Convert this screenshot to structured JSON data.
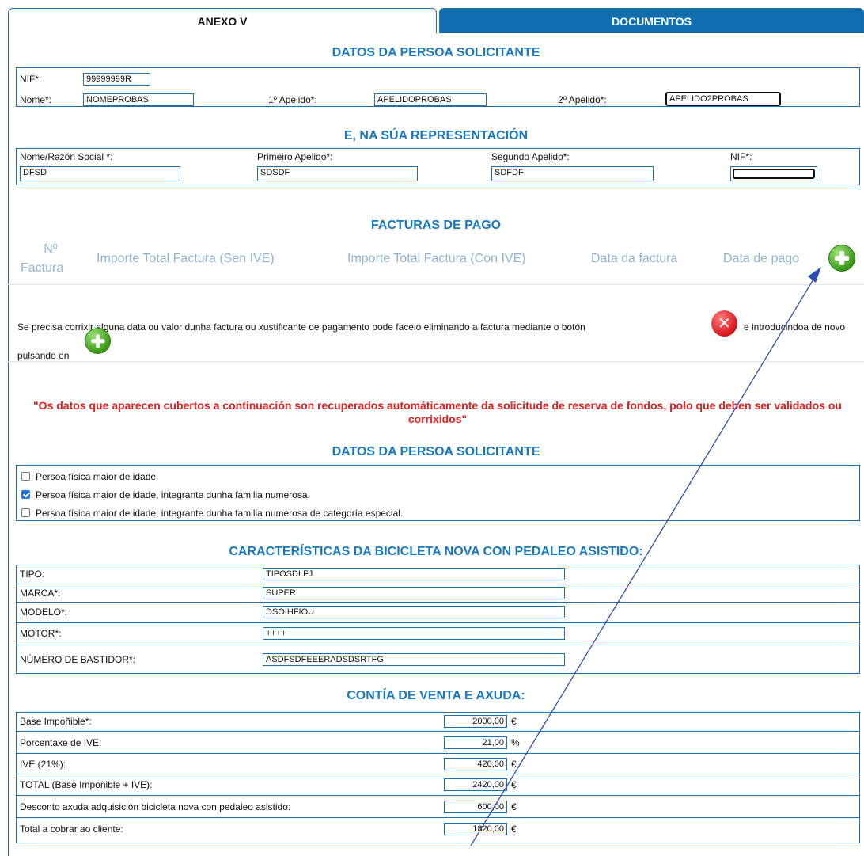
{
  "tabs": {
    "anexo": "ANEXO V",
    "documentos": "DOCUMENTOS"
  },
  "solicitante": {
    "title": "DATOS DA PERSOA SOLICITANTE",
    "nif_label": "NIF*:",
    "nif": "99999999R",
    "nome_label": "Nome*:",
    "nome": "NOMEPROBAS",
    "ap1_label": "1º Apelido*:",
    "ap1": "APELIDOPROBAS",
    "ap2_label": "2º Apelido*:",
    "ap2": "APELIDO2PROBAS"
  },
  "representacion": {
    "title": "E, NA SÚA REPRESENTACIÓN",
    "nome_label": "Nome/Razón Social *:",
    "nome": "DFSD",
    "ap1_label": "Primeiro Apelido*:",
    "ap1": "SDSDF",
    "ap2_label": "Segundo Apelido*:",
    "ap2": "SDFDF",
    "nif_label": "NIF*:",
    "nif": ""
  },
  "facturas": {
    "title": "FACTURAS DE PAGO",
    "col_num_1": "Nº",
    "col_num_2": "Factura",
    "col_sen_ive": "Importe Total Factura (Sen IVE)",
    "col_con_ive": "Importe Total Factura (Con IVE)",
    "col_data_factura": "Data da factura",
    "col_data_pago": "Data de pago",
    "help_1": "Se precisa corrixir alguna data ou valor dunha factura ou xustificante de pagamento pode facelo eliminando a factura mediante o botón",
    "help_2": "e introducindoa de novo",
    "help_3": "pulsando en"
  },
  "warning": "\"Os datos que aparecen cubertos a continuación son recuperados automáticamente da solicitude de reserva de fondos, polo que deben ser validados ou corrixidos\"",
  "tipo_solicitante": {
    "title": "DATOS DA PERSOA SOLICITANTE",
    "options": [
      {
        "label": "Persoa física maior de idade",
        "checked": false
      },
      {
        "label": "Persoa física maior de idade, integrante dunha familia numerosa.",
        "checked": true
      },
      {
        "label": "Persoa física maior de idade, integrante dunha familia numerosa de categoría especial.",
        "checked": false
      }
    ]
  },
  "bicicleta": {
    "title": "CARACTERÍSTICAS DA BICICLETA NOVA CON PEDALEO ASISTIDO:",
    "rows": [
      {
        "label": "TIPO:",
        "value": "TIPOSDLFJ"
      },
      {
        "label": "MARCA*:",
        "value": "SUPER"
      },
      {
        "label": "MODELO*:",
        "value": "DSOIHFIOU"
      },
      {
        "label": "MOTOR*:",
        "value": "++++"
      },
      {
        "label": "NÚMERO DE BASTIDOR*:",
        "value": "ASDFSDFEEERADSDSRTFG"
      }
    ]
  },
  "contia": {
    "title": "CONTÍA DE VENTA E AXUDA:",
    "rows": [
      {
        "label": "Base Impoñible*:",
        "value": "2000,00",
        "unit": "€"
      },
      {
        "label": "Porcentaxe de IVE:",
        "value": "21,00",
        "unit": "%"
      },
      {
        "label": "IVE (21%):",
        "value": "420,00",
        "unit": "€"
      },
      {
        "label": "TOTAL (Base Impoñible + IVE):",
        "value": "2420,00",
        "unit": "€"
      },
      {
        "label": "Desconto axuda adquisición bicicleta nova con pedaleo asistido:",
        "value": "600,00",
        "unit": "€"
      },
      {
        "label": "Total a cobrar ao cliente:",
        "value": "1820,00",
        "unit": "€"
      }
    ]
  },
  "colors": {
    "title_blue": "#1879c0",
    "border_blue": "#1f6fa8",
    "tab_blue": "#0f6eb0",
    "warning_red": "#e61e1e",
    "header_grey_blue": "#8fb4d5"
  },
  "icons": [
    "add-icon",
    "delete-icon",
    "checkbox-icon"
  ]
}
